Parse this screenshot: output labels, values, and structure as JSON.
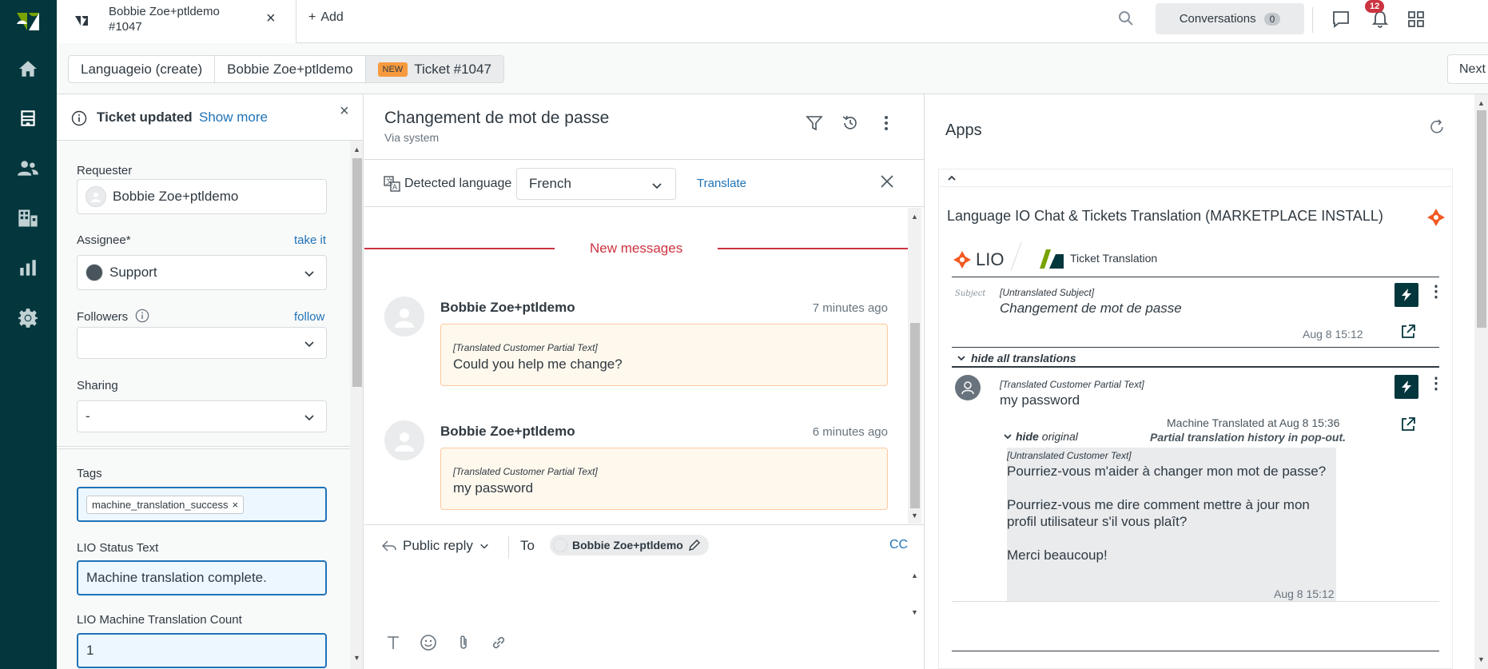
{
  "tab": {
    "title": "Bobbie Zoe+ptldemo",
    "subtitle": "#1047",
    "close": "×"
  },
  "topbar": {
    "add_label": "Add",
    "conversations_label": "Conversations",
    "conversations_count": "0",
    "notifications_count": "12"
  },
  "breadcrumbs": {
    "items": [
      "Languageio (create)",
      "Bobbie Zoe+ptldemo",
      "Ticket #1047"
    ],
    "new_badge": "NEW",
    "next_label": "Next"
  },
  "notice": {
    "title": "Ticket updated",
    "link": "Show more"
  },
  "properties": {
    "requester_label": "Requester",
    "requester_value": "Bobbie Zoe+ptldemo",
    "assignee_label": "Assignee*",
    "assignee_link": "take it",
    "assignee_value": "Support",
    "followers_label": "Followers",
    "followers_link": "follow",
    "sharing_label": "Sharing",
    "sharing_value": "-",
    "tags_label": "Tags",
    "tag_value": "machine_translation_success",
    "lio_status_label": "LIO Status Text",
    "lio_status_value": "Machine translation complete.",
    "lio_count_label": "LIO Machine Translation Count",
    "lio_count_value": "1"
  },
  "conversation": {
    "subject": "Changement de mot de passe",
    "via": "Via system",
    "detected_label": "Detected language",
    "language": "French",
    "translate_label": "Translate",
    "new_messages_label": "New messages",
    "messages": [
      {
        "author": "Bobbie Zoe+ptldemo",
        "time": "7 minutes ago",
        "tag": "[Translated Customer Partial Text]",
        "text": "Could you help me change?"
      },
      {
        "author": "Bobbie Zoe+ptldemo",
        "time": "6 minutes ago",
        "tag": "[Translated Customer Partial Text]",
        "text": "my password"
      }
    ],
    "reply_type": "Public reply",
    "to_label": "To",
    "recipient": "Bobbie Zoe+ptldemo",
    "cc_label": "CC"
  },
  "apps": {
    "title": "Apps",
    "app_name": "Language IO Chat & Tickets Translation (MARKETPLACE INSTALL)",
    "lio_logo": "LIO",
    "ticket_translation_label": "Ticket Translation",
    "subject_icon_text": "Subject",
    "untranslated_subject_tag": "[Untranslated Subject]",
    "untranslated_subject": "Changement de mot de passe",
    "subject_time": "Aug 8 15:12",
    "hide_all_label": "hide all translations",
    "translated_tag": "[Translated Customer Partial Text]",
    "translated_text": "my password",
    "machine_translated": "Machine Translated at Aug 8 15:36",
    "hide_label": "hide",
    "original_label": "original",
    "partial_history": "Partial translation history in pop-out.",
    "untranslated_tag": "[Untranslated Customer Text]",
    "original_lines": [
      "Pourriez-vous m'aider à changer mon mot de passe?",
      "Pourriez-vous me dire comment mettre à jour mon",
      "profil utilisateur s'il vous plaît?",
      "Merci beaucoup!"
    ],
    "original_time": "Aug 8 15:12"
  },
  "colors": {
    "rail": "#03363d",
    "accent": "#1f73b7",
    "alert": "#cc3340",
    "new_badge": "#f79a3e",
    "lio_orange": "#f15a22"
  }
}
